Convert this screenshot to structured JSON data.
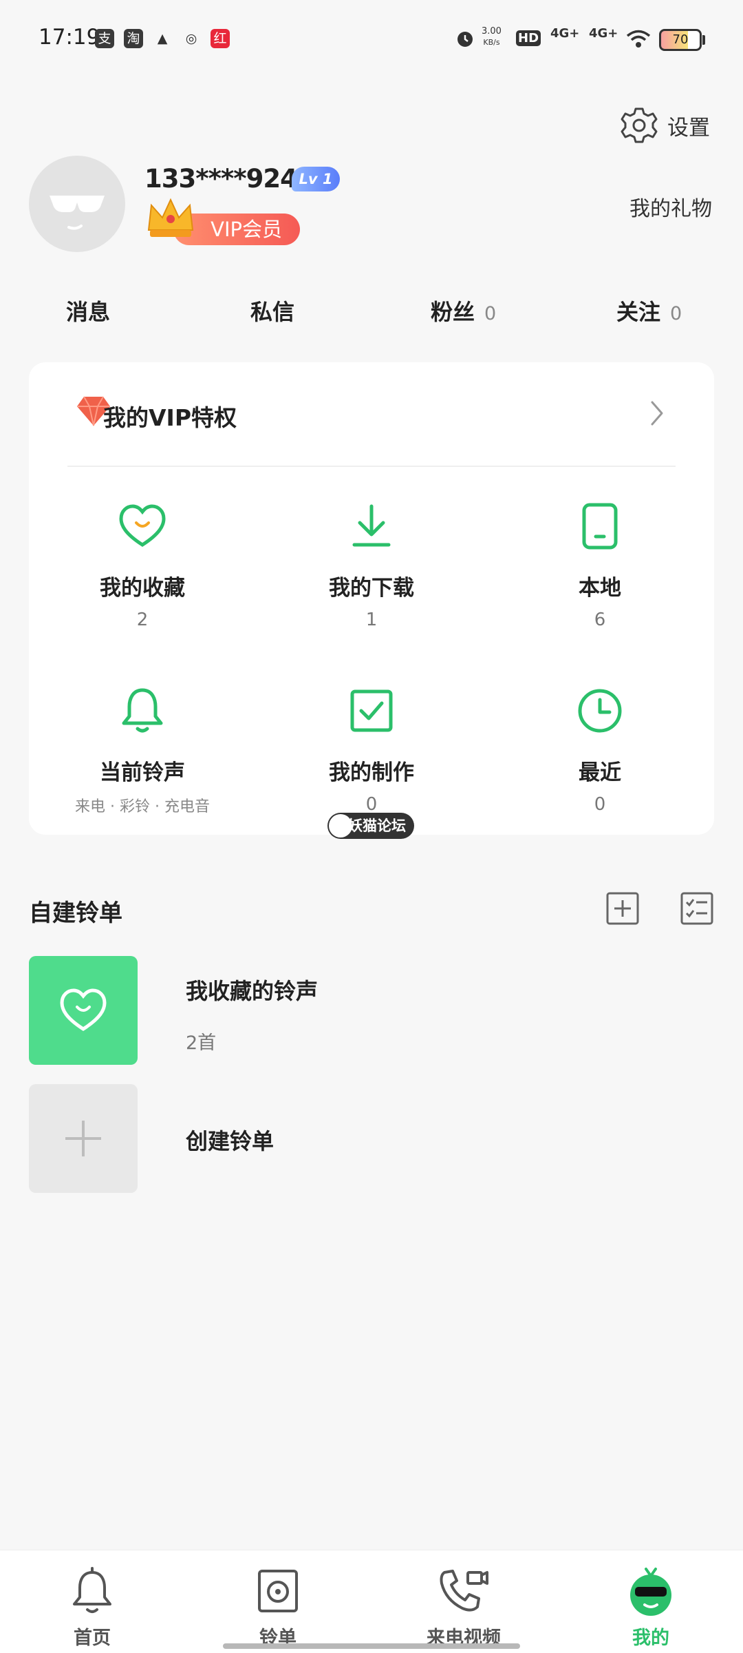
{
  "status_bar": {
    "time": "17:19",
    "apps": [
      "支",
      "淘",
      "▲",
      "◎",
      "红"
    ],
    "net_speed_value": "3.00",
    "net_speed_unit": "KB/s",
    "hd": "HD",
    "net1": "4G+",
    "net2": "4G+",
    "battery": "70"
  },
  "header": {
    "settings_label": "设置",
    "username": "133****9247",
    "level": "Lv 1",
    "vip_label": "VIP会员",
    "gift_label": "我的礼物"
  },
  "stats": [
    {
      "label": "消息",
      "count": ""
    },
    {
      "label": "私信",
      "count": ""
    },
    {
      "label": "粉丝",
      "count": "0"
    },
    {
      "label": "关注",
      "count": "0"
    }
  ],
  "vip_card": {
    "title": "我的VIP特权",
    "items": [
      {
        "label": "我的收藏",
        "sub": "2",
        "icon": "heart-icon"
      },
      {
        "label": "我的下载",
        "sub": "1",
        "icon": "download-icon"
      },
      {
        "label": "本地",
        "sub": "6",
        "icon": "phone-icon"
      },
      {
        "label": "当前铃声",
        "sub": "来电 · 彩铃 · 充电音",
        "icon": "bell-icon"
      },
      {
        "label": "我的制作",
        "sub": "0",
        "icon": "checkbox-icon"
      },
      {
        "label": "最近",
        "sub": "0",
        "icon": "clock-icon"
      }
    ]
  },
  "watermark": "妖猫论坛",
  "playlists": {
    "section_title": "自建铃单",
    "items": [
      {
        "title": "我收藏的铃声",
        "count": "2首"
      },
      {
        "title": "创建铃单",
        "count": ""
      }
    ]
  },
  "colors": {
    "accent": "#2bbf6a",
    "fav_thumb": "#4fdc8c",
    "vip_red": "#f55a55"
  },
  "bottom_nav": [
    {
      "label": "首页",
      "icon": "bell-icon"
    },
    {
      "label": "铃单",
      "icon": "speaker-icon"
    },
    {
      "label": "来电视频",
      "icon": "phone-video-icon"
    },
    {
      "label": "我的",
      "icon": "mascot-icon",
      "active": true
    }
  ]
}
